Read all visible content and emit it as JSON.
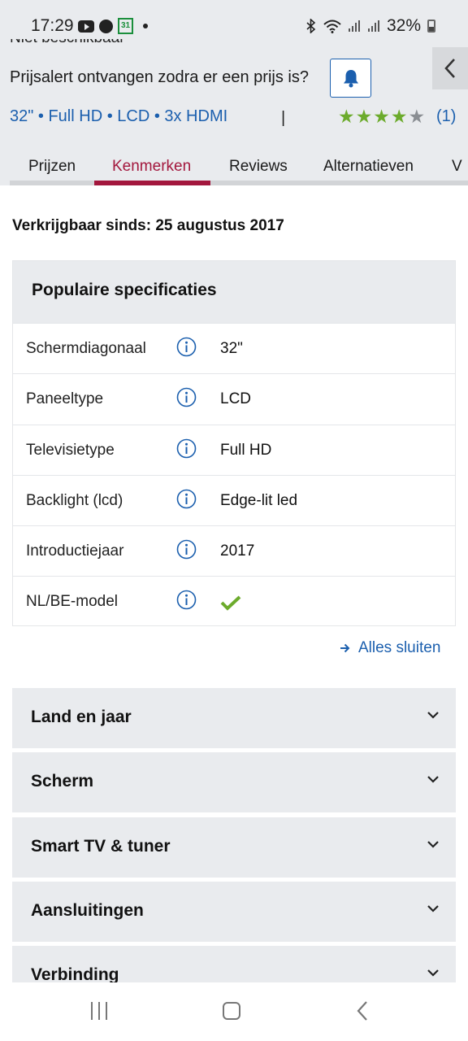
{
  "status_bar": {
    "time": "17:29",
    "calendar_day": "31",
    "battery": "32%"
  },
  "header": {
    "cut_text": "Niet beschikbaar",
    "price_alert": "Prijsalert ontvangen zodra er een prijs is?",
    "specs_summary": "32\" • Full HD • LCD • 3x HDMI",
    "separator": "|",
    "rating": {
      "value": 4,
      "max": 5
    },
    "review_count": "(1)"
  },
  "tabs": [
    {
      "label": "Prijzen",
      "active": false
    },
    {
      "label": "Kenmerken",
      "active": true
    },
    {
      "label": "Reviews",
      "active": false
    },
    {
      "label": "Alternatieven",
      "active": false
    },
    {
      "label": "V",
      "active": false
    }
  ],
  "content": {
    "available_since": "Verkrijgbaar sinds: 25 augustus 2017",
    "popular_title": "Populaire specificaties",
    "specs": [
      {
        "label": "Schermdiagonaal",
        "value": "32\""
      },
      {
        "label": "Paneeltype",
        "value": "LCD"
      },
      {
        "label": "Televisietype",
        "value": "Full HD"
      },
      {
        "label": "Backlight (lcd)",
        "value": "Edge-lit led"
      },
      {
        "label": "Introductiejaar",
        "value": "2017"
      },
      {
        "label": "NL/BE-model",
        "value": ""
      }
    ],
    "close_all": "Alles sluiten",
    "sections": [
      "Land en jaar",
      "Scherm",
      "Smart TV & tuner",
      "Aansluitingen",
      "Verbinding"
    ]
  },
  "colors": {
    "link": "#1b5fae",
    "active_tab": "#a3173d",
    "star": "#6cab2c",
    "check": "#6cab2c",
    "panel_bg": "#e9ebee"
  }
}
